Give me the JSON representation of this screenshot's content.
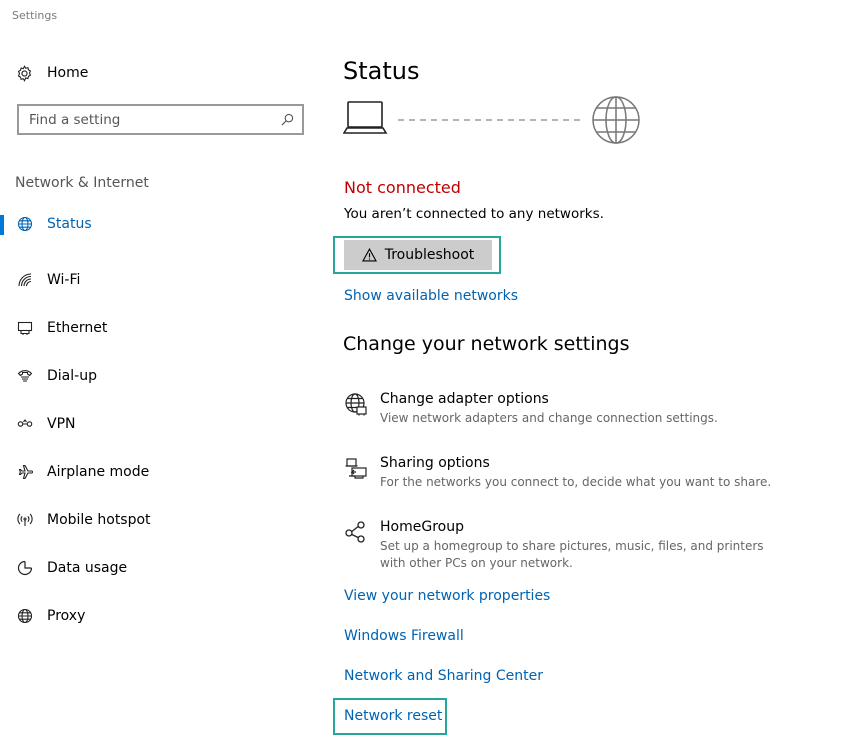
{
  "window": {
    "title": "Settings"
  },
  "sidebar": {
    "home_label": "Home",
    "search_placeholder": "Find a setting",
    "section_label": "Network & Internet",
    "items": [
      {
        "label": "Status",
        "icon": "globe-status-icon",
        "active": true
      },
      {
        "label": "Wi-Fi",
        "icon": "wifi-icon",
        "active": false
      },
      {
        "label": "Ethernet",
        "icon": "ethernet-icon",
        "active": false
      },
      {
        "label": "Dial-up",
        "icon": "dialup-icon",
        "active": false
      },
      {
        "label": "VPN",
        "icon": "vpn-icon",
        "active": false
      },
      {
        "label": "Airplane mode",
        "icon": "airplane-icon",
        "active": false
      },
      {
        "label": "Mobile hotspot",
        "icon": "hotspot-icon",
        "active": false
      },
      {
        "label": "Data usage",
        "icon": "data-usage-icon",
        "active": false
      },
      {
        "label": "Proxy",
        "icon": "proxy-globe-icon",
        "active": false
      }
    ]
  },
  "main": {
    "title": "Status",
    "status_heading": "Not connected",
    "status_description": "You aren’t connected to any networks.",
    "troubleshoot_label": "Troubleshoot",
    "show_networks_link": "Show available networks",
    "change_heading": "Change your network settings",
    "settings": [
      {
        "title": "Change adapter options",
        "description": "View network adapters and change connection settings.",
        "icon": "adapter-globe-icon"
      },
      {
        "title": "Sharing options",
        "description": "For the networks you connect to, decide what you want to share.",
        "icon": "sharing-icon"
      },
      {
        "title": "HomeGroup",
        "description": "Set up a homegroup to share pictures, music, files, and printers with other PCs on your network.",
        "icon": "homegroup-icon"
      }
    ],
    "links": {
      "network_properties": "View your network properties",
      "firewall": "Windows Firewall",
      "sharing_center": "Network and Sharing Center",
      "network_reset": "Network reset"
    }
  },
  "colors": {
    "accent": "#0078d7",
    "link": "#0063b1",
    "error": "#c00000",
    "highlight_frame": "#26a69a"
  }
}
